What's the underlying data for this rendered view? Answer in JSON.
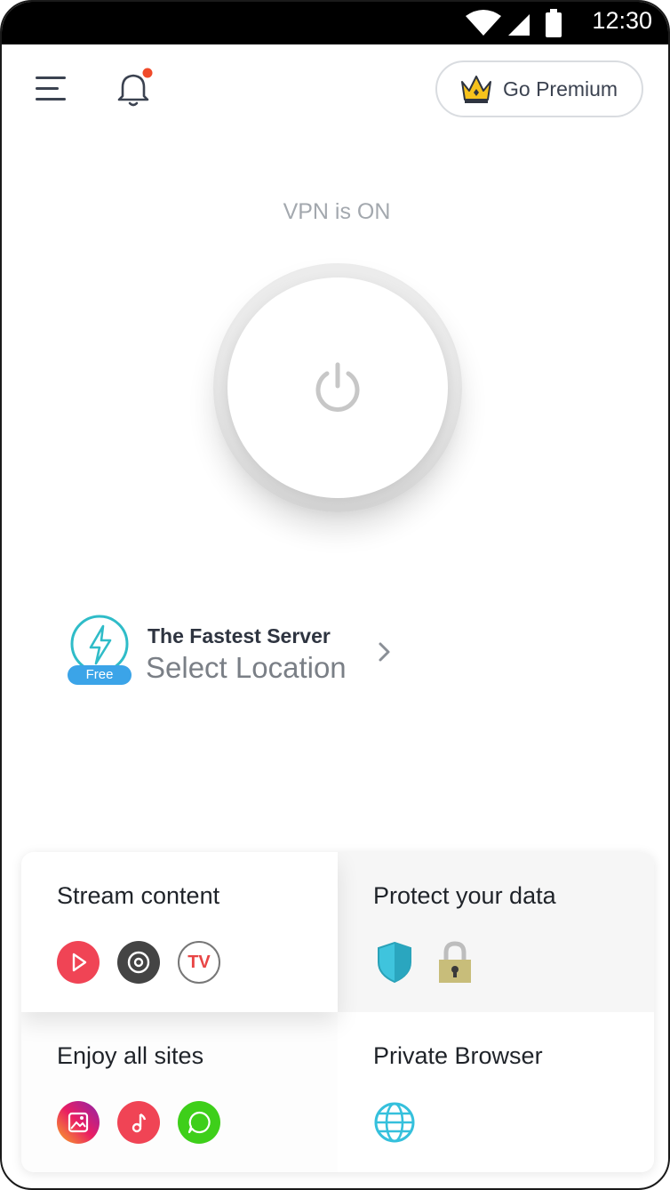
{
  "status_bar": {
    "time": "12:30"
  },
  "header": {
    "premium_label": "Go Premium"
  },
  "vpn": {
    "status": "VPN is ON"
  },
  "location": {
    "title": "The Fastest Server",
    "subtitle": "Select Location",
    "badge": "Free"
  },
  "features": {
    "stream": {
      "title": "Stream content",
      "tv_label": "TV"
    },
    "protect": {
      "title": "Protect your data"
    },
    "sites": {
      "title": "Enjoy all sites"
    },
    "browser": {
      "title": "Private Browser"
    }
  },
  "colors": {
    "accent_blue": "#3ba4e8",
    "teal": "#2fbcc8",
    "notification_dot": "#f04a2a",
    "red": "#f04455",
    "dark": "#444444",
    "green": "#3ecf1a"
  }
}
